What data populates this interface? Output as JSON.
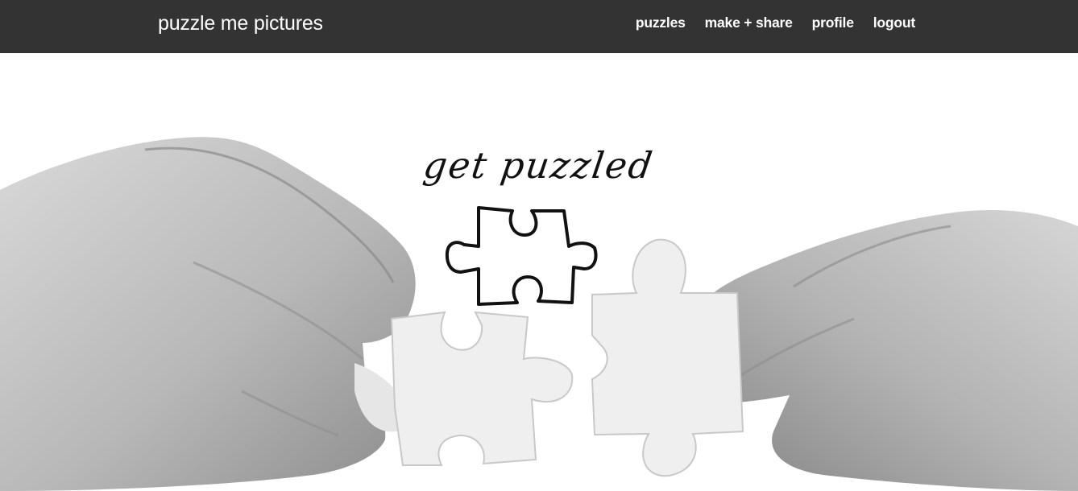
{
  "header": {
    "brand": "puzzle me pictures",
    "nav": [
      {
        "label": "puzzles"
      },
      {
        "label": "make + share"
      },
      {
        "label": "profile"
      },
      {
        "label": "logout"
      }
    ]
  },
  "hero": {
    "tagline": "get puzzled",
    "outline_icon": "puzzle-piece-outline-icon"
  },
  "colors": {
    "navbar_bg": "#333333",
    "nav_text": "#ffffff",
    "background": "#ffffff"
  }
}
